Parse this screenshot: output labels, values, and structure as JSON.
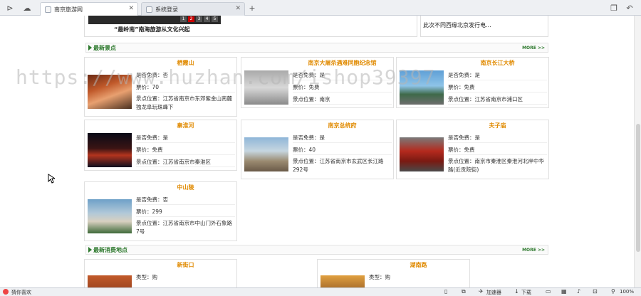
{
  "tabs": [
    {
      "label": "南京旅游网",
      "active": true
    },
    {
      "label": "系统登录",
      "active": false
    }
  ],
  "news": {
    "caption": "“最岭南”南海旅游从文化兴起",
    "right_text": "此次不同西缘北京发行电...",
    "pager": [
      "1",
      "2",
      "3",
      "4",
      "5"
    ]
  },
  "sections": {
    "spots_title": "最新景点",
    "hot_title": "最新消费地点",
    "more_label": "MORE >>"
  },
  "watermark": "https://www.huzhan.com/ishop39397",
  "spots": [
    {
      "name": "栖霞山",
      "free": "是否免费：否",
      "price": "票价：70",
      "loc": "景点位置：江苏省南京市东郊紫金山南麓独龙阜玩珠峰下"
    },
    {
      "name": "南京大屠杀遇难同胞纪念馆",
      "free": "是否免费：是",
      "price": "票价：免费",
      "loc": "景点位置：南京"
    },
    {
      "name": "南京长江大桥",
      "free": "是否免费：是",
      "price": "票价：免费",
      "loc": "景点位置：江苏省南京市浦口区"
    },
    {
      "name": "秦淮河",
      "free": "是否免费：是",
      "price": "票价：免费",
      "loc": "景点位置：江苏省南京市秦淮区"
    },
    {
      "name": "南京总统府",
      "free": "是否免费：是",
      "price": "票价：40",
      "loc": "景点位置：江苏省南京市玄武区长江路292号"
    },
    {
      "name": "夫子庙",
      "free": "是否免费：是",
      "price": "票价：免费",
      "loc": "景点位置：南京市秦淮区秦淮河北岸中华路(近贡院街)"
    },
    {
      "name": "中山陵",
      "free": "是否免费：否",
      "price": "票价：299",
      "loc": "景点位置：江苏省南京市中山门外石象路7号"
    }
  ],
  "shops": [
    {
      "name": "新街口",
      "type": "类型：购"
    },
    {
      "name": "湖南路",
      "type": "类型：购"
    }
  ],
  "status": {
    "left": "猜你喜欢",
    "accelerator": "加速器",
    "download": "下载",
    "zoom": "100%"
  }
}
